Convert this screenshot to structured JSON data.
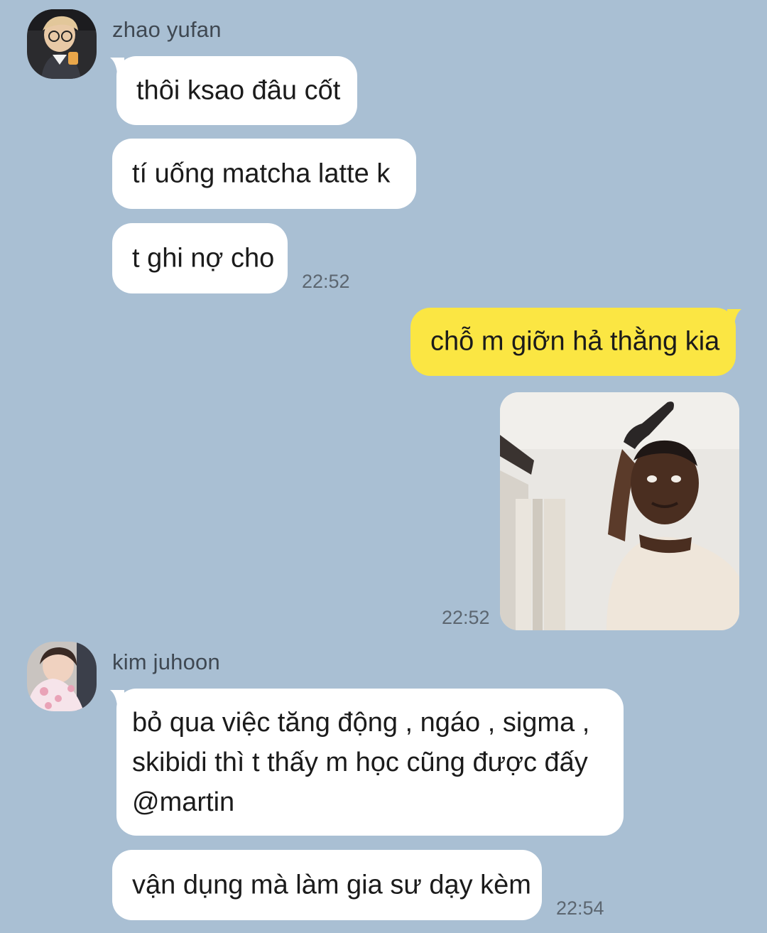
{
  "messages": [
    {
      "sender": "zhao yufan",
      "side": "left",
      "avatar_icon": "user-avatar-icon",
      "lines": [
        "thôi ksao đâu cốt",
        "tí uống matcha latte k",
        "t ghi nợ cho"
      ],
      "time": "22:52"
    },
    {
      "sender": "me",
      "side": "right",
      "text": "chỗ m giỡn hả thằng kia",
      "photo_icon": "photo-icon",
      "time": "22:52"
    },
    {
      "sender": "kim juhoon",
      "side": "left",
      "avatar_icon": "user-avatar-icon",
      "multiline_text": [
        "bỏ qua việc tăng động , ngáo , sigma ,",
        "skibidi thì t thấy m học cũng được đấy",
        "@martin"
      ],
      "last_line": "vận dụng mà làm gia sư dạy kèm",
      "time": "22:54"
    }
  ],
  "colors": {
    "background": "#a9bfd3",
    "incoming_bubble": "#ffffff",
    "outgoing_bubble": "#fbe643"
  }
}
